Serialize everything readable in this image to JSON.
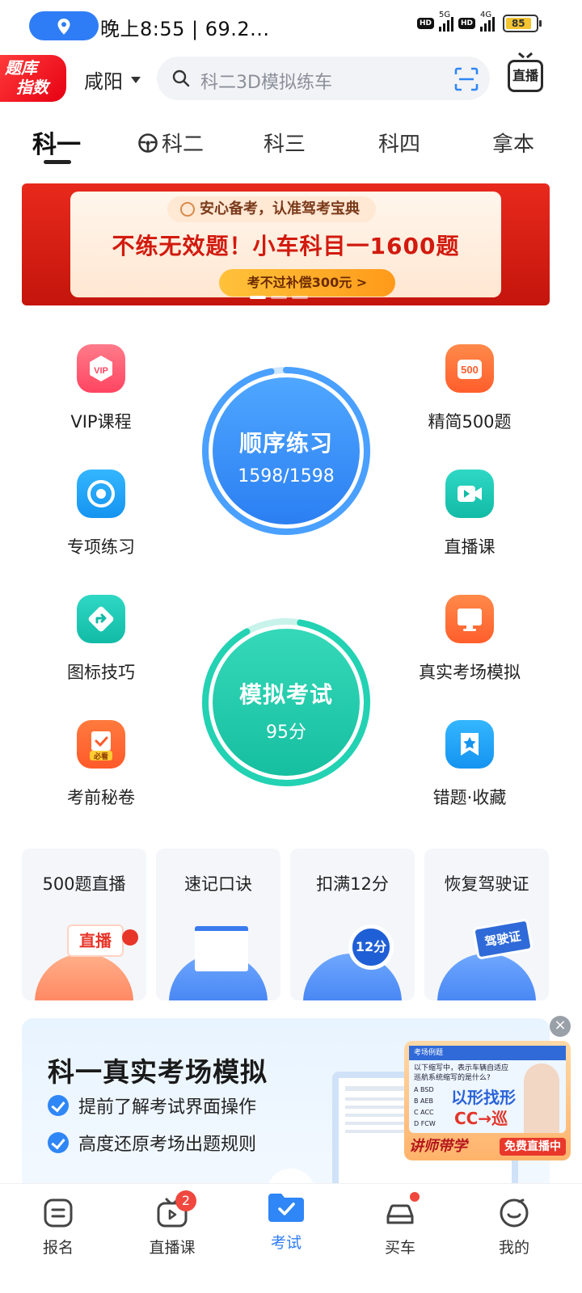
{
  "status_bar": {
    "time_text": "晚上8:55 | 69.2...",
    "network1": "5G",
    "network2": "4G",
    "hd": "HD",
    "battery": "85"
  },
  "header": {
    "brand_badge_line1": "题库",
    "brand_badge_line2": "指数",
    "city": "咸阳",
    "search_placeholder": "科二3D模拟练车",
    "live_label": "直播"
  },
  "tabs": [
    {
      "label": "科一",
      "active": true
    },
    {
      "label": "科二",
      "active": false
    },
    {
      "label": "科三",
      "active": false
    },
    {
      "label": "科四",
      "active": false
    },
    {
      "label": "拿本",
      "active": false
    }
  ],
  "banner": {
    "tagline": "安心备考，认准驾考宝典",
    "headline": "不练无效题！小车科目一1600题",
    "cta": "考不过补偿300元 >"
  },
  "features_left": [
    {
      "label": "VIP课程",
      "icon": "vip-icon",
      "color": "#ff5a6a"
    },
    {
      "label": "专项练习",
      "icon": "target-icon",
      "color": "#1aa4f4"
    },
    {
      "label": "图标技巧",
      "icon": "road-sign-icon",
      "color": "#18c7b5"
    },
    {
      "label": "考前秘卷",
      "icon": "exam-paper-icon",
      "color": "#ff6a3a"
    }
  ],
  "features_right": [
    {
      "label": "精简500题",
      "icon": "500-icon",
      "color": "#ff6a3a"
    },
    {
      "label": "直播课",
      "icon": "video-icon",
      "color": "#18c7b5"
    },
    {
      "label": "真实考场模拟",
      "icon": "monitor-icon",
      "color": "#ff6a3a"
    },
    {
      "label": "错题·收藏",
      "icon": "bookmark-star-icon",
      "color": "#1aa4f4"
    }
  ],
  "practice": {
    "title": "顺序练习",
    "progress": "1598/1598",
    "progress_fraction": 1.0
  },
  "exam": {
    "title": "模拟考试",
    "score": "95分"
  },
  "quick_cards": [
    {
      "title": "500题直播",
      "illustration_text": "直播"
    },
    {
      "title": "速记口诀",
      "illustration_text": ""
    },
    {
      "title": "扣满12分",
      "illustration_text": "12分"
    },
    {
      "title": "恢复驾驶证",
      "illustration_text": "驾驶证"
    }
  ],
  "promo": {
    "title": "科一真实考场模拟",
    "lines": [
      "提前了解考试界面操作",
      "高度还原考场出题规则"
    ]
  },
  "float_ad": {
    "header": "考场例题",
    "question": "以下缩写中，表示车辆自适应巡航系统缩写的是什么?",
    "options": [
      "A BSD",
      "B AEB",
      "C ACC",
      "D FCW"
    ],
    "big_text": "以形找形",
    "cc_text": "CC→巡",
    "bottom_left": "讲师带学",
    "bottom_right": "免费直播中"
  },
  "bottom_nav": [
    {
      "label": "报名",
      "icon": "signup-icon",
      "active": false,
      "badge": ""
    },
    {
      "label": "直播课",
      "icon": "tv-icon",
      "active": false,
      "badge": "2"
    },
    {
      "label": "考试",
      "icon": "exam-folder-icon",
      "active": true,
      "badge": ""
    },
    {
      "label": "买车",
      "icon": "car-icon",
      "active": false,
      "badge": "dot"
    },
    {
      "label": "我的",
      "icon": "smile-icon",
      "active": false,
      "badge": ""
    }
  ],
  "colors": {
    "accent": "#2f7df6",
    "banner_red": "#d21a0e",
    "practice_blue": "#3a8cf6",
    "exam_green": "#1fd0b0"
  }
}
